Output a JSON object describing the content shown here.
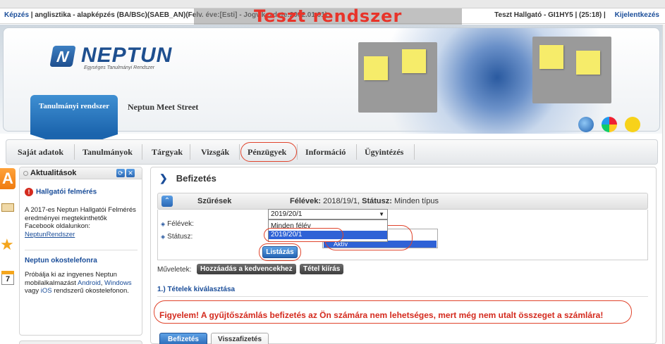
{
  "infobar": {
    "course_link": "Képzés",
    "course_text": "| anglisztika - alapképzés (BA/BSc)(SAEB_AN)(Felv. éve:[Esti] - Jogv.kezdete:2002.01.01)",
    "test_banner": "Teszt rendszer",
    "user": "Teszt Hallgató - GI1HY5",
    "timer": "| (25:18) |",
    "logout": "Kijelentkezés"
  },
  "header": {
    "logo_letter": "N",
    "logo": "NEPTUN",
    "logo_sub": "Egységes Tanulmányi Rendszer",
    "tab_main": "Tanulmányi rendszer",
    "tab_meet": "Neptun Meet Street"
  },
  "menu": {
    "items": [
      "Saját adatok",
      "Tanulmányok",
      "Tárgyak",
      "Vizsgák",
      "Pénzügyek",
      "Információ",
      "Ügyintézés"
    ]
  },
  "side": {
    "cal_day": "7"
  },
  "news": {
    "title": "Aktualitások",
    "section1_title": "Hallgatói felmérés",
    "section1_text": "A 2017-es Neptun Hallgatói Felmérés eredményei megtekinthetők Facebook oldalunkon:",
    "section1_link": "NeptunRendszer",
    "section2_title": "Neptun okostelefonra",
    "section2_text_a": "Próbálja ki az ingyenes Neptun mobilalkalmazást",
    "section2_android": "Android",
    "section2_windows": "Windows",
    "section2_vagy": "vagy",
    "section2_ios": "iOS",
    "section2_text_b": "rendszerű okostelefonon."
  },
  "main": {
    "title": "Befizetés",
    "filter_title": "Szűrések",
    "filter_summary_label1": "Félévek:",
    "filter_summary_value1": "2018/19/1,",
    "filter_summary_label2": "Státusz:",
    "filter_summary_value2": "Minden típus",
    "label_semesters": "Félévek:",
    "label_status": "Státusz:",
    "select_value": "2019/20/1",
    "dropdown_options": [
      "Minden félév",
      "2019/20/1"
    ],
    "status_option": "Aktív",
    "list_button": "Listázás",
    "ops_label": "Műveletek:",
    "btn_favorites": "Hozzáadás a kedvencekhez",
    "btn_print": "Tétel kiírás",
    "section_title": "1.) Tételek kiválasztása",
    "warning": "Figyelem! A gyűjtőszámlás befizetés az Ön számára nem lehetséges, mert még nem utalt összeget a számlára!",
    "tab_pay": "Befizetés",
    "tab_refund": "Visszafizetés"
  },
  "colors": {
    "brand_blue": "#1a4d99",
    "highlight_red": "#e0442c",
    "warning_red": "#d42a1e",
    "selection_blue": "#2f62d6"
  }
}
